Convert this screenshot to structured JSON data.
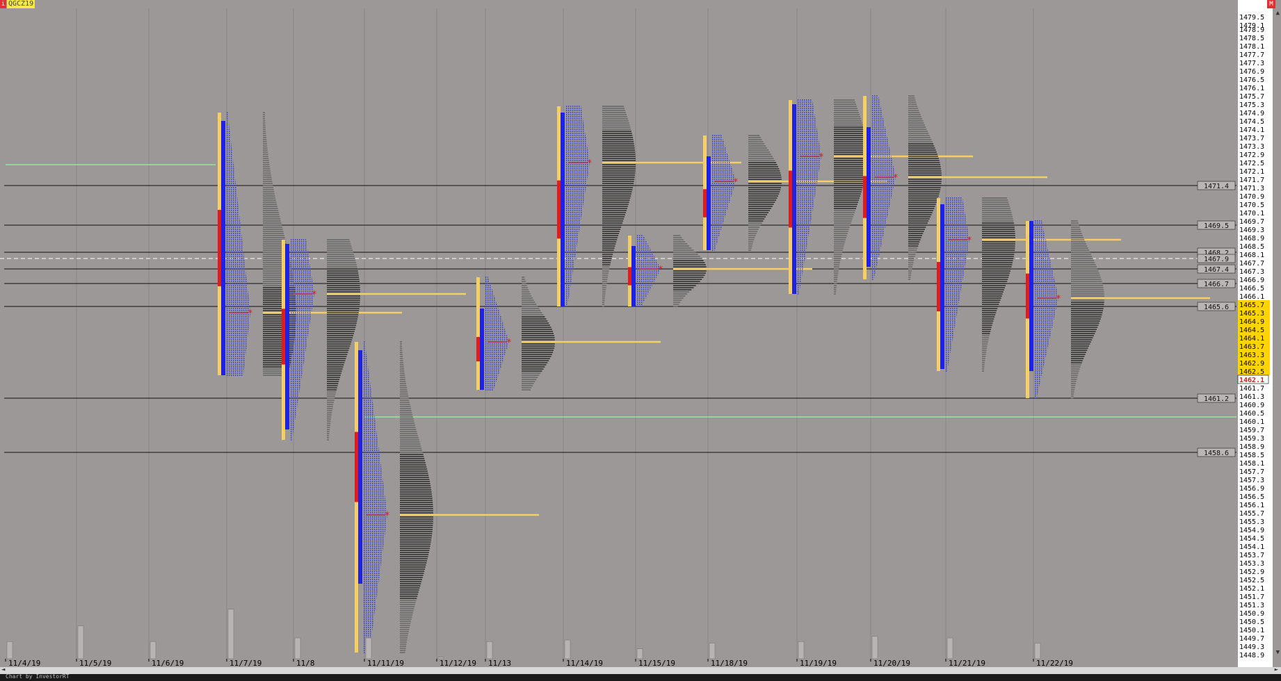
{
  "app": {
    "symbol": "QGCZ19",
    "info_icon": "i",
    "menu_icon": "M",
    "footer_text": "Chart by InvestorRT",
    "scroll_up": "▲",
    "scroll_down": "▼",
    "scroll_left": "◄",
    "scroll_right": "►"
  },
  "colors": {
    "background": "#9c9898",
    "blue": "#1e22e6",
    "dotted_blue": "#2430e8",
    "red": "#e21b1b",
    "yellow": "#f5cf63",
    "black": "#111111",
    "dark_gray": "#5a5a5a",
    "green_line": "#8ee89b",
    "value_highlight": "#ffd400"
  },
  "chart_data": {
    "type": "market_profile",
    "instrument": "QGCZ19",
    "ylim": [
      1448.7,
      1479.9
    ],
    "price_scale": [
      "1479.5",
      "1479.1",
      "1478.9",
      "1478.5",
      "1478.1",
      "1477.7",
      "1477.3",
      "1476.9",
      "1476.5",
      "1476.1",
      "1475.7",
      "1475.3",
      "1474.9",
      "1474.5",
      "1474.1",
      "1473.7",
      "1473.3",
      "1472.9",
      "1472.5",
      "1472.1",
      "1471.7",
      "1471.3",
      "1470.9",
      "1470.5",
      "1470.1",
      "1469.7",
      "1469.3",
      "1468.9",
      "1468.5",
      "1468.1",
      "1467.7",
      "1467.3",
      "1466.9",
      "1466.5",
      "1466.1",
      "1465.7",
      "1465.3",
      "1464.9",
      "1464.5",
      "1464.1",
      "1463.7",
      "1463.3",
      "1462.9",
      "1462.5",
      "1462.1",
      "1461.7",
      "1461.3",
      "1460.9",
      "1460.5",
      "1460.1",
      "1459.7",
      "1459.3",
      "1458.9",
      "1458.5",
      "1458.1",
      "1457.7",
      "1457.3",
      "1456.9",
      "1456.5",
      "1456.1",
      "1455.7",
      "1455.3",
      "1454.9",
      "1454.5",
      "1454.1",
      "1453.7",
      "1453.3",
      "1452.9",
      "1452.5",
      "1452.1",
      "1451.7",
      "1451.3",
      "1450.9",
      "1450.5",
      "1450.1",
      "1449.7",
      "1449.3",
      "1448.9"
    ],
    "highlight_range": [
      1462.5,
      1465.7
    ],
    "current_price": "1462.1",
    "dates": [
      "11/4/19",
      "11/5/19",
      "11/6/19",
      "11/7/19",
      "11/8",
      "11/11/19",
      "11/12/19",
      "11/13",
      "11/14/19",
      "11/15/19",
      "11/18/19",
      "11/19/19",
      "11/20/19",
      "11/21/19",
      "11/22/19"
    ],
    "level_labels": [
      "1471.4",
      "1469.5",
      "1468.2",
      "1467.9",
      "1467.4",
      "1466.7",
      "1465.6",
      "1461.2",
      "1458.6"
    ],
    "reference_lines": [
      {
        "price": 1471.4,
        "kind": "black"
      },
      {
        "price": 1469.5,
        "kind": "black"
      },
      {
        "price": 1468.2,
        "kind": "black"
      },
      {
        "price": 1467.9,
        "kind": "dashed"
      },
      {
        "price": 1467.4,
        "kind": "black"
      },
      {
        "price": 1466.7,
        "kind": "black"
      },
      {
        "price": 1465.6,
        "kind": "black"
      },
      {
        "price": 1461.2,
        "kind": "black"
      },
      {
        "price": 1458.6,
        "kind": "black"
      }
    ],
    "green_lines": [
      {
        "price": 1472.4,
        "from_day": "11/4/19",
        "to_day": "11/7/19"
      },
      {
        "price": 1460.3,
        "from_day": "11/11/19",
        "to_day": "extend"
      }
    ],
    "sessions": [
      {
        "date": "11/7/19",
        "high": 1474.9,
        "low": 1462.3,
        "poc": 1465.3,
        "ib_high": 1474.5,
        "ib_low": 1462.3,
        "vah": 1466.5,
        "val": 1462.6
      },
      {
        "date": "11/8",
        "high": 1468.8,
        "low": 1459.2,
        "poc": 1466.2,
        "ib_high": 1468.6,
        "ib_low": 1459.7,
        "vah": 1467.4,
        "val": 1461.5
      },
      {
        "date": "11/11/19",
        "high": 1463.9,
        "low": 1449.0,
        "poc": 1455.6,
        "ib_high": 1463.5,
        "ib_low": 1452.3,
        "vah": 1458.5,
        "val": 1451.5
      },
      {
        "date": "11/13",
        "high": 1467.0,
        "low": 1461.6,
        "poc": 1463.9,
        "ib_high": 1465.5,
        "ib_low": 1461.6,
        "vah": 1465.1,
        "val": 1462.4
      },
      {
        "date": "11/14/19",
        "high": 1475.2,
        "low": 1465.6,
        "poc": 1472.5,
        "ib_high": 1474.9,
        "ib_low": 1465.6,
        "vah": 1474.0,
        "val": 1467.5
      },
      {
        "date": "11/15/19",
        "high": 1469.0,
        "low": 1465.6,
        "poc": 1467.4,
        "ib_high": 1468.5,
        "ib_low": 1465.6,
        "vah": 1467.8,
        "val": 1466.3
      },
      {
        "date": "11/18/19",
        "high": 1473.8,
        "low": 1468.3,
        "poc": 1471.6,
        "ib_high": 1472.8,
        "ib_low": 1468.3,
        "vah": 1472.5,
        "val": 1469.6
      },
      {
        "date": "11/19/19",
        "high": 1475.5,
        "low": 1466.2,
        "poc": 1472.8,
        "ib_high": 1475.3,
        "ib_low": 1466.2,
        "vah": 1474.2,
        "val": 1470.2
      },
      {
        "date": "11/20/19",
        "high": 1475.7,
        "low": 1466.9,
        "poc": 1471.8,
        "ib_high": 1474.2,
        "ib_low": 1467.5,
        "vah": 1473.4,
        "val": 1468.4
      },
      {
        "date": "11/21/19",
        "high": 1470.8,
        "low": 1462.5,
        "poc": 1468.8,
        "ib_high": 1470.5,
        "ib_low": 1462.6,
        "vah": 1469.6,
        "val": 1464.2
      },
      {
        "date": "11/22/19",
        "high": 1469.7,
        "low": 1461.2,
        "poc": 1466.0,
        "ib_high": 1469.7,
        "ib_low": 1462.5,
        "vah": 1465.8,
        "val": 1462.8
      }
    ],
    "volume": [
      0.33,
      0.63,
      0.33,
      0.95,
      0.4,
      0.4,
      0.03,
      0.33,
      0.36,
      0.19,
      0.3,
      0.33,
      0.43,
      0.4,
      0.3
    ]
  }
}
